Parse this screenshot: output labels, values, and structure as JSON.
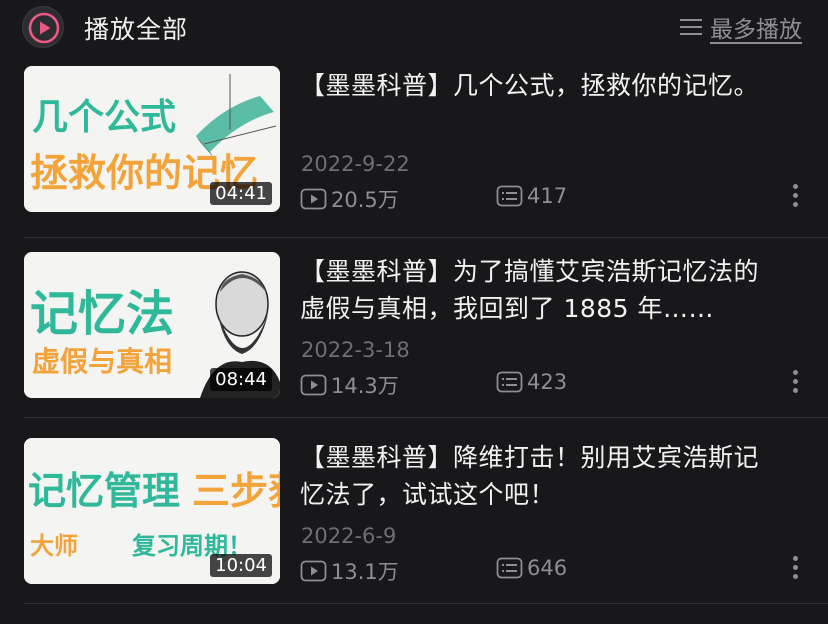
{
  "header": {
    "play_all_label": "播放全部",
    "sort_icon": "list-icon",
    "sort_label": "最多播放"
  },
  "videos": [
    {
      "title": "【墨墨科普】几个公式，拯救你的记忆。",
      "date": "2022-9-22",
      "plays": "20.5万",
      "comments": "417",
      "duration": "04:41",
      "thumb_lines": [
        "几个公式",
        "拯救你的记忆"
      ]
    },
    {
      "title": "【墨墨科普】为了搞懂艾宾浩斯记忆法的虚假与真相，我回到了 1885 年……",
      "date": "2022-3-18",
      "plays": "14.3万",
      "comments": "423",
      "duration": "08:44",
      "thumb_lines": [
        "记忆法",
        "虚假与真相"
      ]
    },
    {
      "title": "【墨墨科普】降维打击！别用艾宾浩斯记忆法了，试试这个吧！",
      "date": "2022-6-9",
      "plays": "13.1万",
      "comments": "646",
      "duration": "10:04",
      "thumb_lines": [
        "记忆管理",
        "大师",
        "三步获取",
        "复习周期！"
      ]
    }
  ],
  "colors": {
    "accent": "#e85a83",
    "thumb_green": "#2fb99a",
    "thumb_orange": "#f2a33a"
  }
}
